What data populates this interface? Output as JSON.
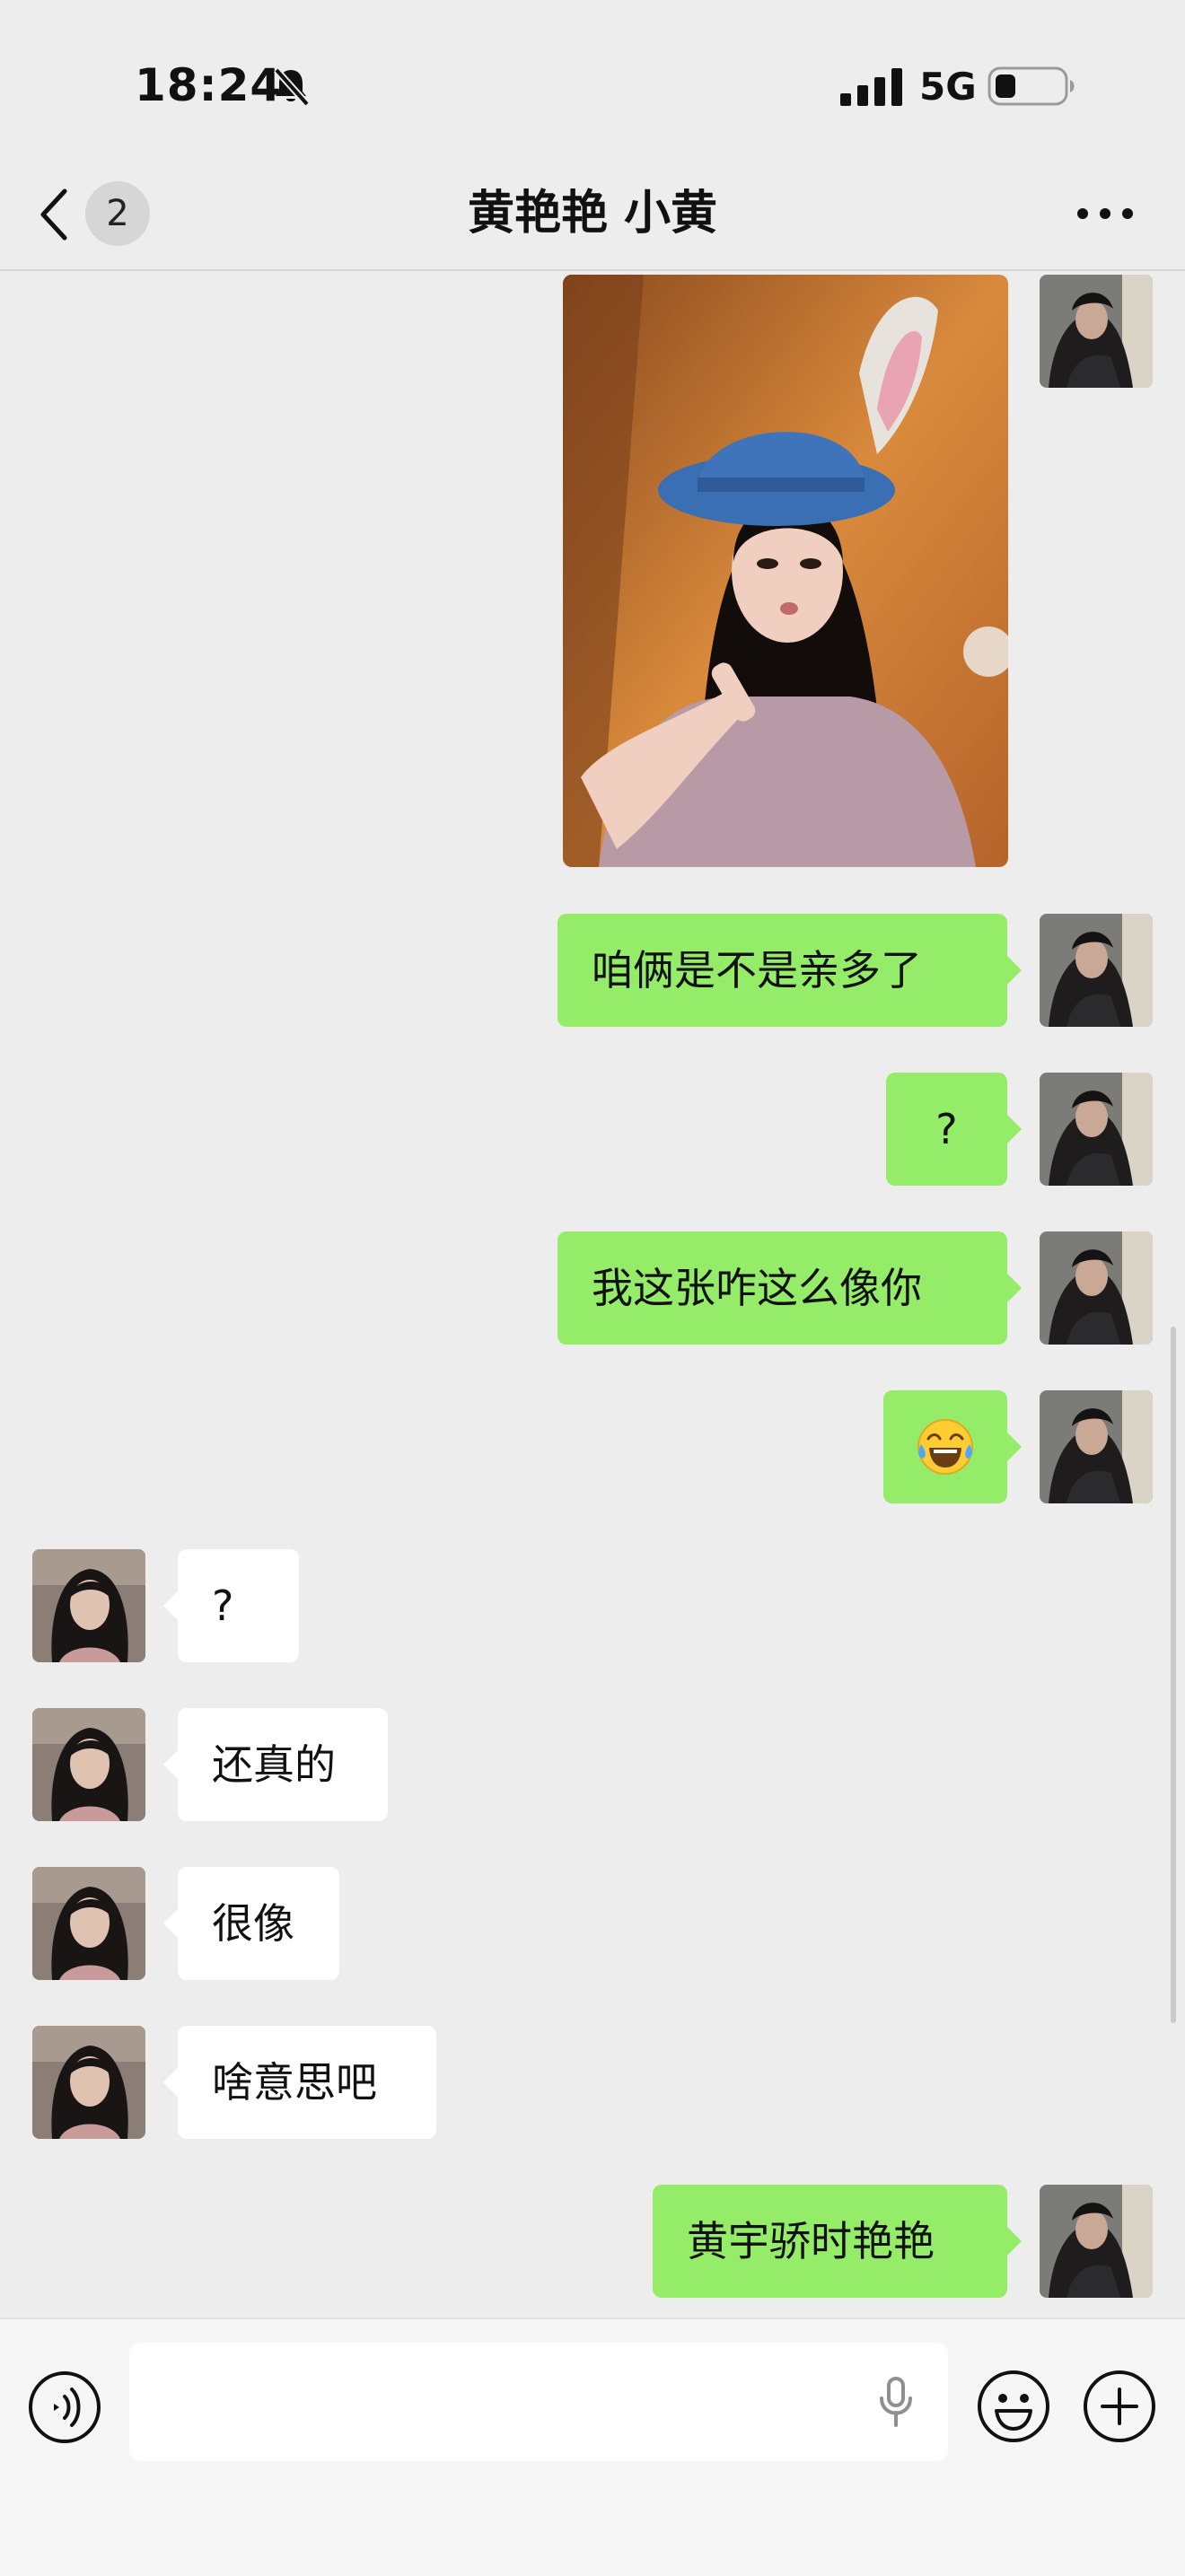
{
  "status_bar": {
    "time": "18:24",
    "network": "5G",
    "silent_icon": "bell-slash-icon"
  },
  "header": {
    "back_count": "2",
    "title": "黄艳艳 小黄",
    "more_icon": "ellipsis-icon"
  },
  "messages": [
    {
      "sender": "me",
      "type": "image",
      "content": "photo"
    },
    {
      "sender": "me",
      "type": "text",
      "content": "咱俩是不是亲多了"
    },
    {
      "sender": "me",
      "type": "text",
      "content": "?"
    },
    {
      "sender": "me",
      "type": "text",
      "content": "我这张咋这么像你"
    },
    {
      "sender": "me",
      "type": "emoji",
      "content": "😂"
    },
    {
      "sender": "them",
      "type": "text",
      "content": "?"
    },
    {
      "sender": "them",
      "type": "text",
      "content": "还真的"
    },
    {
      "sender": "them",
      "type": "text",
      "content": "很像"
    },
    {
      "sender": "them",
      "type": "text",
      "content": "啥意思吧"
    },
    {
      "sender": "me",
      "type": "text",
      "content": "黄宇骄时艳艳"
    }
  ],
  "input_bar": {
    "text": "",
    "icons": [
      "voice-icon",
      "microphone-icon",
      "emoji-icon",
      "plus-icon"
    ]
  },
  "colors": {
    "background": "#ededed",
    "my_bubble": "#95ec69",
    "their_bubble": "#ffffff"
  }
}
